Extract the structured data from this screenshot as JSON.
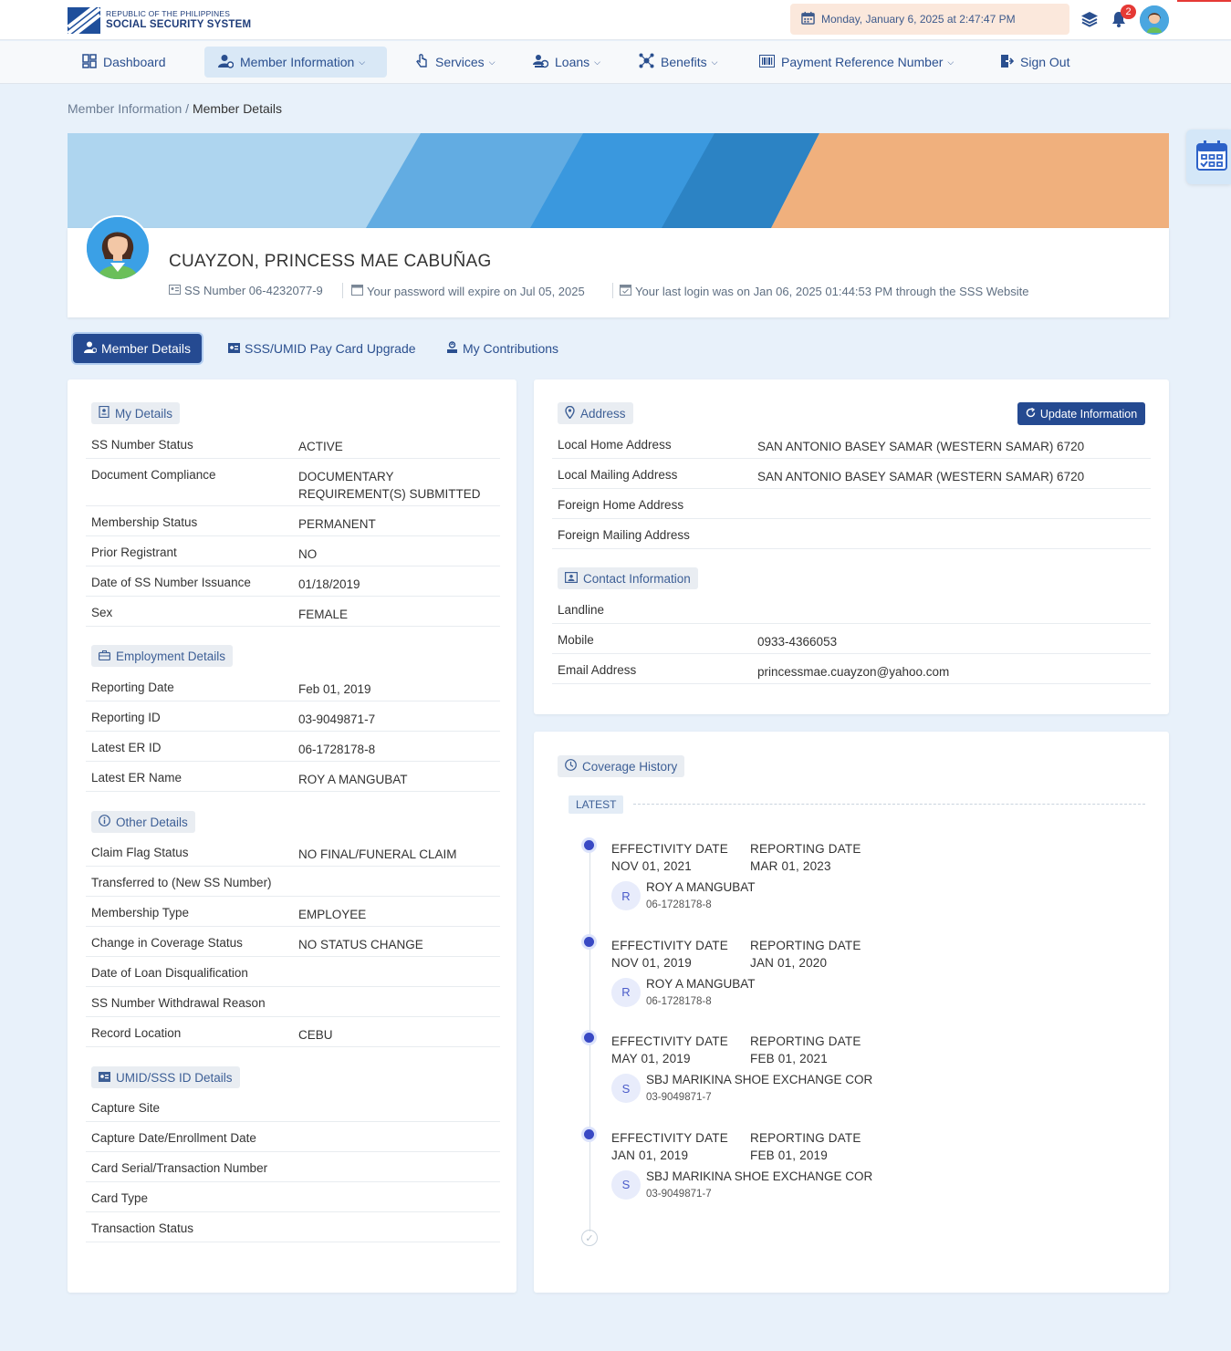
{
  "header": {
    "logo_line1": "REPUBLIC OF THE PHILIPPINES",
    "logo_line2": "SOCIAL SECURITY SYSTEM",
    "datetime": "Monday, January 6, 2025 at 2:47:47 PM",
    "notification_count": "2"
  },
  "nav": {
    "dashboard": "Dashboard",
    "member_information": "Member Information",
    "services": "Services",
    "loans": "Loans",
    "benefits": "Benefits",
    "payment_reference": "Payment Reference Number",
    "sign_out": "Sign Out"
  },
  "breadcrumb": {
    "parent": "Member Information /",
    "current": "Member Details"
  },
  "profile": {
    "name": "CUAYZON, PRINCESS MAE CABUÑAG",
    "ss_number": "SS Number 06-4232077-9",
    "password_expiry": "Your password will expire on Jul 05, 2025",
    "last_login": "Your last login was on Jan 06, 2025 01:44:53 PM through the SSS Website"
  },
  "tabs": {
    "member_details": "Member Details",
    "pay_card": "SSS/UMID Pay Card Upgrade",
    "contributions": "My Contributions"
  },
  "my_details": {
    "title": "My Details",
    "rows": [
      {
        "label": "SS Number Status",
        "value": "ACTIVE"
      },
      {
        "label": "Document Compliance",
        "value": "DOCUMENTARY REQUIREMENT(S) SUBMITTED"
      },
      {
        "label": "Membership Status",
        "value": "PERMANENT"
      },
      {
        "label": "Prior Registrant",
        "value": "NO"
      },
      {
        "label": "Date of SS Number Issuance",
        "value": "01/18/2019"
      },
      {
        "label": "Sex",
        "value": "FEMALE"
      }
    ]
  },
  "employment": {
    "title": "Employment Details",
    "rows": [
      {
        "label": "Reporting Date",
        "value": "Feb 01, 2019"
      },
      {
        "label": "Reporting ID",
        "value": "03-9049871-7"
      },
      {
        "label": "Latest ER ID",
        "value": "06-1728178-8"
      },
      {
        "label": "Latest ER Name",
        "value": "ROY A MANGUBAT"
      }
    ]
  },
  "other_details": {
    "title": "Other Details",
    "rows": [
      {
        "label": "Claim Flag Status",
        "value": "NO FINAL/FUNERAL CLAIM"
      },
      {
        "label": "Transferred to (New SS Number)",
        "value": ""
      },
      {
        "label": "Membership Type",
        "value": "EMPLOYEE"
      },
      {
        "label": "Change in Coverage Status",
        "value": "NO STATUS CHANGE"
      },
      {
        "label": "Date of Loan Disqualification",
        "value": ""
      },
      {
        "label": "SS Number Withdrawal Reason",
        "value": ""
      },
      {
        "label": "Record Location",
        "value": "CEBU"
      }
    ]
  },
  "umid": {
    "title": "UMID/SSS ID Details",
    "rows": [
      {
        "label": "Capture Site",
        "value": ""
      },
      {
        "label": "Capture Date/Enrollment Date",
        "value": ""
      },
      {
        "label": "Card Serial/Transaction Number",
        "value": ""
      },
      {
        "label": "Card Type",
        "value": ""
      },
      {
        "label": "Transaction Status",
        "value": ""
      }
    ]
  },
  "address": {
    "title": "Address",
    "update_button": "Update Information",
    "rows": [
      {
        "label": "Local Home Address",
        "value": "SAN ANTONIO BASEY SAMAR (WESTERN SAMAR) 6720"
      },
      {
        "label": "Local Mailing Address",
        "value": "SAN ANTONIO BASEY SAMAR (WESTERN SAMAR) 6720"
      },
      {
        "label": "Foreign Home Address",
        "value": ""
      },
      {
        "label": "Foreign Mailing Address",
        "value": ""
      }
    ]
  },
  "contact": {
    "title": "Contact Information",
    "rows": [
      {
        "label": "Landline",
        "value": ""
      },
      {
        "label": "Mobile",
        "value": "0933-4366053"
      },
      {
        "label": "Email Address",
        "value": "princessmae.cuayzon@yahoo.com"
      }
    ]
  },
  "coverage": {
    "title": "Coverage History",
    "latest_tag": "LATEST",
    "eff_label": "EFFECTIVITY DATE",
    "rep_label": "REPORTING DATE",
    "entries": [
      {
        "eff": "NOV 01, 2021",
        "rep": "MAR 01, 2023",
        "initial": "R",
        "er": "ROY A MANGUBAT",
        "id": "06-1728178-8"
      },
      {
        "eff": "NOV 01, 2019",
        "rep": "JAN 01, 2020",
        "initial": "R",
        "er": "ROY A MANGUBAT",
        "id": "06-1728178-8"
      },
      {
        "eff": "MAY 01, 2019",
        "rep": "FEB 01, 2021",
        "initial": "S",
        "er": "SBJ MARIKINA SHOE EXCHANGE COR",
        "id": "03-9049871-7"
      },
      {
        "eff": "JAN 01, 2019",
        "rep": "FEB 01, 2019",
        "initial": "S",
        "er": "SBJ MARIKINA SHOE EXCHANGE COR",
        "id": "03-9049871-7"
      }
    ]
  }
}
